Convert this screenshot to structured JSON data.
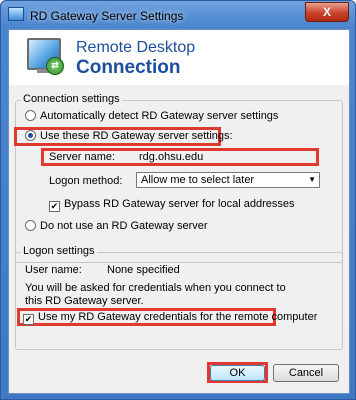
{
  "window": {
    "title": "RD Gateway Server Settings",
    "close_label": "X"
  },
  "banner": {
    "line1": "Remote Desktop",
    "line2": "Connection"
  },
  "connection_settings": {
    "title": "Connection settings",
    "auto_detect_label": "Automatically detect RD Gateway server settings",
    "use_these_label": "Use these RD Gateway server settings:",
    "server_name_label": "Server name:",
    "server_name_value": "rdg.ohsu.edu",
    "logon_method_label": "Logon method:",
    "logon_method_value": "Allow me to select later",
    "bypass_label": "Bypass RD Gateway server for local addresses",
    "do_not_use_label": "Do not use an RD Gateway server"
  },
  "logon_settings": {
    "title": "Logon settings",
    "user_name_label": "User name:",
    "user_name_value": "None specified",
    "credentials_note": "You will be asked for credentials when you connect to this RD Gateway server.",
    "use_credentials_label": "Use my RD Gateway credentials for the remote computer"
  },
  "buttons": {
    "ok": "OK",
    "cancel": "Cancel"
  },
  "colors": {
    "highlight": "#e0392f",
    "title_bar": "#4c86cf"
  }
}
